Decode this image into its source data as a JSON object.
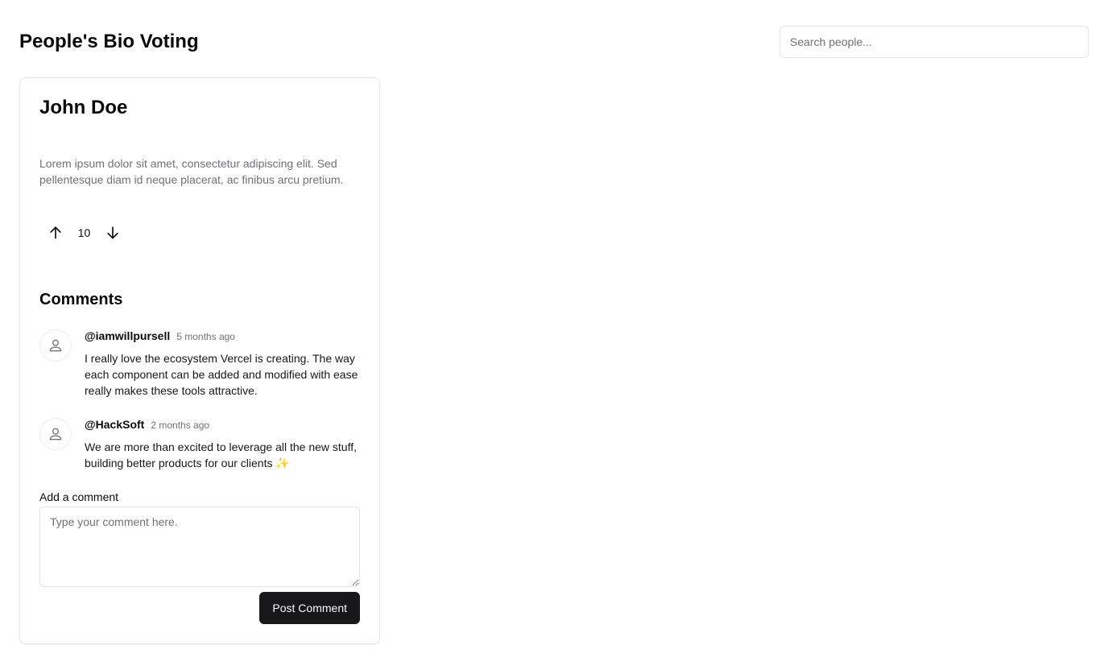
{
  "header": {
    "title": "People's Bio Voting",
    "search_placeholder": "Search people...",
    "search_value": ""
  },
  "person": {
    "name": "John Doe",
    "bio": "Lorem ipsum dolor sit amet, consectetur adipiscing elit. Sed pellentesque diam id neque placerat, ac finibus arcu pretium.",
    "votes": "10",
    "upvote_icon": "arrow-up-icon",
    "downvote_icon": "arrow-down-icon"
  },
  "comments": {
    "title": "Comments",
    "items": [
      {
        "author": "@iamwillpursell",
        "time": "5 months ago",
        "text": "I really love the ecosystem Vercel is creating. The way each component can be added and modified with ease really makes these tools attractive.",
        "avatar_icon": "user-icon"
      },
      {
        "author": "@HackSoft",
        "time": "2 months ago",
        "text": "We are more than excited to leverage all the new stuff, building better products for our clients ✨",
        "avatar_icon": "user-icon"
      }
    ],
    "add_label": "Add a comment",
    "textarea_placeholder": "Type your comment here.",
    "textarea_value": "",
    "post_label": "Post Comment"
  },
  "colors": {
    "primary_button": "#18181b",
    "muted_text": "#71717a",
    "border": "#e4e4e7"
  }
}
